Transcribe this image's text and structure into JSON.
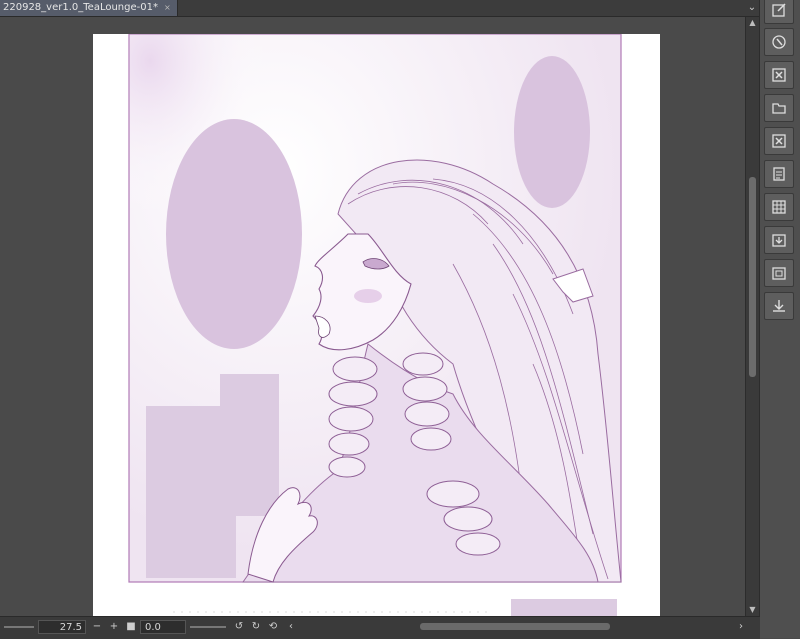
{
  "document": {
    "tab_title": "220928_ver1.0_TeaLounge-01*",
    "close_glyph": "×",
    "tab_menu_glyph": "⌄"
  },
  "status_bar": {
    "zoom_value": "27.5",
    "rotation_value": "0.0",
    "zoom_out_glyph": "−",
    "zoom_in_glyph": "+",
    "scroll_left_glyph": "‹",
    "scroll_right_glyph": "›"
  },
  "right_panel": {
    "buttons": [
      {
        "icon": "edit-square-icon"
      },
      {
        "icon": "search-circle-icon"
      },
      {
        "icon": "close-box-icon"
      },
      {
        "icon": "folder-icon"
      },
      {
        "icon": "close-box-icon"
      },
      {
        "icon": "document-list-icon"
      },
      {
        "icon": "grid-icon"
      },
      {
        "icon": "import-image-icon"
      },
      {
        "icon": "layer-window-icon"
      },
      {
        "icon": "download-icon"
      }
    ]
  },
  "colors": {
    "lavender": "#d9c4de",
    "line_purple": "#a06aa6",
    "panel_dark": "#4a4a4a"
  }
}
